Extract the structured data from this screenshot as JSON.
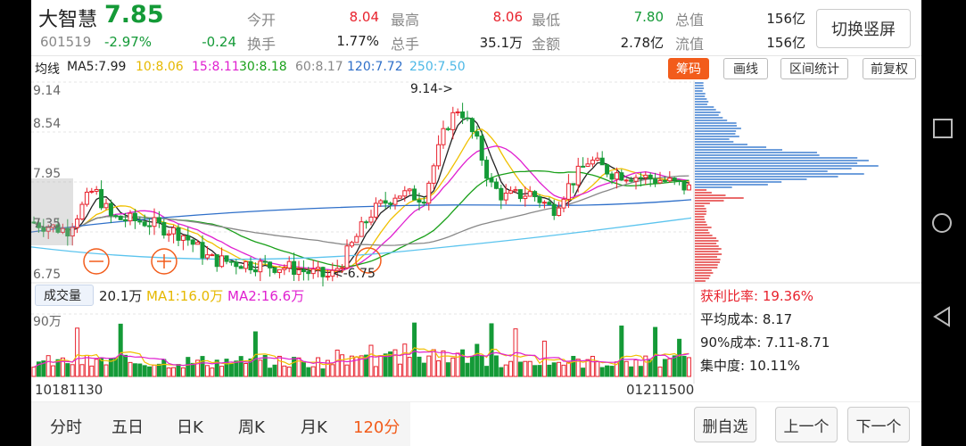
{
  "stock": {
    "name": "大智慧",
    "price": "7.85",
    "code": "601519",
    "change_pct": "-2.97%",
    "change": "-0.24"
  },
  "quote_grid": [
    {
      "label": "今开",
      "value": "8.04",
      "label2": "最高",
      "value2": "8.06",
      "label3": "最低",
      "value3": "7.80",
      "label4": "总值",
      "value4": "156亿"
    },
    {
      "label": "换手",
      "value": "1.77%",
      "label2": "总手",
      "value2": "35.1万",
      "label3": "金额",
      "value3": "2.78亿",
      "label4": "流值",
      "value4": "156亿"
    }
  ],
  "switch_label": "切换竖屏",
  "ma_bar": {
    "label": "均线",
    "ma5": "MA5:7.99",
    "ma10": "10:8.06",
    "ma15": "15:8.11",
    "ma30": "30:8.18",
    "ma60": "60:8.17",
    "ma120": "120:7.72",
    "ma250": "250:7.50"
  },
  "toolbar": {
    "chouma": "筹码",
    "draw": "画线",
    "range": "区间统计",
    "restore": "前复权"
  },
  "price_axis": {
    "high": "9.14",
    "l2": "8.54",
    "l3": "7.95",
    "l4": "7.35",
    "low": "6.75"
  },
  "markers": {
    "high": "9.14->",
    "low": "<-6.75"
  },
  "volume": {
    "tab": "成交量",
    "value": "20.1万",
    "ma1": "MA1:16.0万",
    "ma2": "MA2:16.6万",
    "axis_max": "90万"
  },
  "chip_stats": {
    "profit_ratio": "获利比率: 19.36%",
    "avg_cost": "平均成本: 8.17",
    "cost_90": "90%成本: 7.11-8.71",
    "concentration": "集中度: 10.11%"
  },
  "time_axis": {
    "start": "10181130",
    "end": "01211500"
  },
  "period_tabs": [
    "分时",
    "五日",
    "日K",
    "周K",
    "月K",
    "120分"
  ],
  "period_selected": "120分",
  "bottom_buttons": {
    "remove": "删自选",
    "prev": "上一个",
    "next": "下一个"
  },
  "colors": {
    "up": "#e8222d",
    "down": "#149a37",
    "ma5": "#222222",
    "ma10": "#f0c000",
    "ma15": "#e020d0",
    "ma30": "#1aa01a",
    "ma60": "#888888",
    "ma120": "#2e6fc9",
    "ma250": "#5bc4ee",
    "accent": "#f25c1b"
  }
}
